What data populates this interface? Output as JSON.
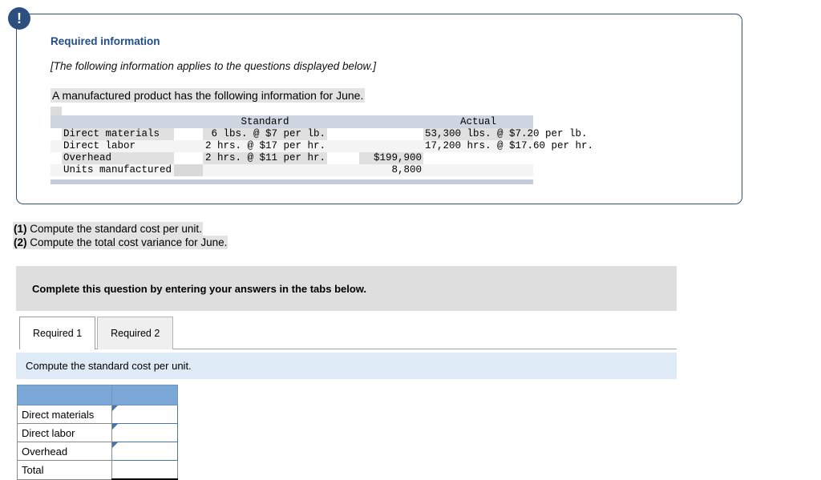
{
  "alert": {
    "icon": "exclamation-icon",
    "glyph": "!"
  },
  "panel": {
    "heading": "Required information",
    "note": "[The following information applies to the questions displayed below.]",
    "lead": "A manufactured product has the following information for June."
  },
  "info_table": {
    "columns": [
      "",
      "Standard",
      "Actual"
    ],
    "headers": {
      "standard": "Standard",
      "actual": "Actual"
    },
    "rows": [
      {
        "label": "Direct materials",
        "standard": "6 lbs. @ $7 per lb.",
        "actual": "53,300 lbs. @ $7.20 per lb."
      },
      {
        "label": "Direct labor",
        "standard": "2 hrs. @ $17 per hr.",
        "actual": "17,200 hrs. @ $17.60 per hr."
      },
      {
        "label": "Overhead",
        "standard": "2 hrs. @ $11 per hr.",
        "actual": "$199,900"
      },
      {
        "label": "Units manufactured",
        "standard": "",
        "actual": "8,800"
      }
    ],
    "detail": {
      "dm_std_qty": "6 lbs.",
      "dm_std_rate": "$7 per lb.",
      "dl_std_qty": "2 hrs.",
      "dl_std_rate": "$17 per hr.",
      "oh_std_qty": "2 hrs.",
      "oh_std_rate": "$11 per hr.",
      "dm_act_qty": "53,300 lbs.",
      "dm_act_rate": "$7.20 per lb.",
      "dl_act_qty": "17,200 hrs.",
      "dl_act_rate": "$17.60 per hr.",
      "oh_act_total": "$199,900",
      "units_actual": "8,800"
    }
  },
  "questions": [
    {
      "num": "(1)",
      "text": " Compute the standard cost per unit."
    },
    {
      "num": "(2)",
      "text": " Compute the total cost variance for June."
    }
  ],
  "instruction_banner": {
    "text": "Complete this question by entering your answers in the tabs below."
  },
  "tabs": [
    {
      "label": "Required 1",
      "active": true
    },
    {
      "label": "Required 2",
      "active": false
    }
  ],
  "sub_banner": {
    "text": "Compute the standard cost per unit."
  },
  "answer_table": {
    "header_label": "",
    "rows": [
      {
        "label": "Direct materials",
        "value": "",
        "type": "input"
      },
      {
        "label": "Direct labor",
        "value": "",
        "type": "input"
      },
      {
        "label": "Overhead",
        "value": "",
        "type": "input"
      },
      {
        "label": "Total",
        "value": "",
        "type": "total"
      }
    ]
  },
  "colors": {
    "panel_border": "#2f4f7f",
    "badge": "#2c4f80",
    "heading": "#1f4e87",
    "banner_grey": "#dedede",
    "banner_blue": "#dfeaf7",
    "table_header_blue": "#7ba7d7",
    "input_border": "#4a77ab",
    "info_header_row": "#cfd5e0"
  }
}
